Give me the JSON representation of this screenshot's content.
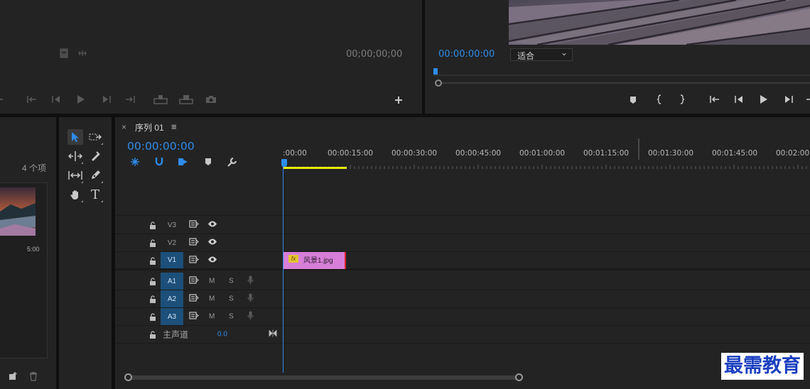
{
  "source_monitor": {
    "timecode": "00;00;00;00"
  },
  "program_monitor": {
    "timecode": "00:00:00:00",
    "fit_value": "适合",
    "fit_arrow": "⌄"
  },
  "project": {
    "item_count": "4 个项",
    "thumb_duration": "5:00"
  },
  "timeline": {
    "close_glyph": "×",
    "tab_title": "序列 01",
    "menu_glyph": "≡",
    "timecode": "00:00:00:00",
    "ruler_labels": [
      ":00:00",
      "00:00:15:00",
      "00:00:30:00",
      "00:00:45:00",
      "00:01:00:00",
      "00:01:15:00",
      "00:01:30:00",
      "00:01:45:00",
      "00:02:00:00"
    ],
    "video_tracks": [
      {
        "name": "V3",
        "targeted": false
      },
      {
        "name": "V2",
        "targeted": false
      },
      {
        "name": "V1",
        "targeted": true
      }
    ],
    "audio_tracks": [
      {
        "name": "A1",
        "mute": "M",
        "solo": "S"
      },
      {
        "name": "A2",
        "mute": "M",
        "solo": "S"
      },
      {
        "name": "A3",
        "mute": "M",
        "solo": "S"
      }
    ],
    "master": {
      "label": "主声道",
      "value": "0.0"
    },
    "clip": {
      "name": "风景1.jpg",
      "fx_badge": "fx",
      "color": "#d77fd8"
    }
  },
  "tools": {
    "type_tool_glyph": "T"
  },
  "watermark": "最需教育",
  "colors": {
    "accent_blue": "#2d8ceb",
    "panel_bg": "#232323",
    "clip_pink": "#d77fd8",
    "work_area_yellow": "#e8e800"
  }
}
